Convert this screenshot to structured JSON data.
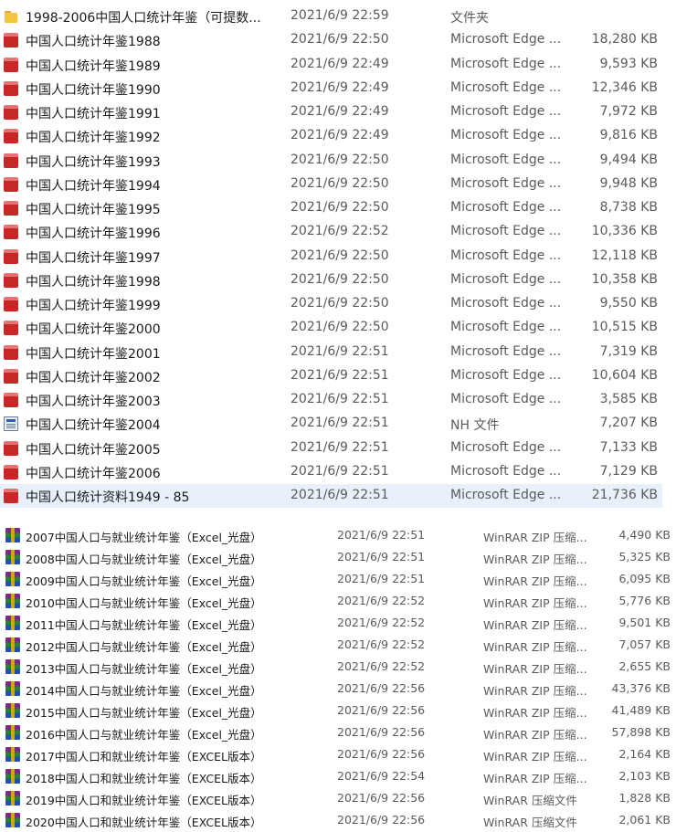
{
  "top_list": [
    {
      "icon": "folder-icon",
      "name": "1998-2006中国人口统计年鉴（可提数...",
      "date": "2021/6/9 22:59",
      "type": "文件夹",
      "size": ""
    },
    {
      "icon": "pdf-icon",
      "name": "中国人口统计年鉴1988",
      "date": "2021/6/9 22:50",
      "type": "Microsoft Edge ...",
      "size": "18,280 KB"
    },
    {
      "icon": "pdf-icon",
      "name": "中国人口统计年鉴1989",
      "date": "2021/6/9 22:49",
      "type": "Microsoft Edge ...",
      "size": "9,593 KB"
    },
    {
      "icon": "pdf-icon",
      "name": "中国人口统计年鉴1990",
      "date": "2021/6/9 22:49",
      "type": "Microsoft Edge ...",
      "size": "12,346 KB"
    },
    {
      "icon": "pdf-icon",
      "name": "中国人口统计年鉴1991",
      "date": "2021/6/9 22:49",
      "type": "Microsoft Edge ...",
      "size": "7,972 KB"
    },
    {
      "icon": "pdf-icon",
      "name": "中国人口统计年鉴1992",
      "date": "2021/6/9 22:49",
      "type": "Microsoft Edge ...",
      "size": "9,816 KB"
    },
    {
      "icon": "pdf-icon",
      "name": "中国人口统计年鉴1993",
      "date": "2021/6/9 22:50",
      "type": "Microsoft Edge ...",
      "size": "9,494 KB"
    },
    {
      "icon": "pdf-icon",
      "name": "中国人口统计年鉴1994",
      "date": "2021/6/9 22:50",
      "type": "Microsoft Edge ...",
      "size": "9,948 KB"
    },
    {
      "icon": "pdf-icon",
      "name": "中国人口统计年鉴1995",
      "date": "2021/6/9 22:50",
      "type": "Microsoft Edge ...",
      "size": "8,738 KB"
    },
    {
      "icon": "pdf-icon",
      "name": "中国人口统计年鉴1996",
      "date": "2021/6/9 22:52",
      "type": "Microsoft Edge ...",
      "size": "10,336 KB"
    },
    {
      "icon": "pdf-icon",
      "name": "中国人口统计年鉴1997",
      "date": "2021/6/9 22:50",
      "type": "Microsoft Edge ...",
      "size": "12,118 KB"
    },
    {
      "icon": "pdf-icon",
      "name": "中国人口统计年鉴1998",
      "date": "2021/6/9 22:50",
      "type": "Microsoft Edge ...",
      "size": "10,358 KB"
    },
    {
      "icon": "pdf-icon",
      "name": "中国人口统计年鉴1999",
      "date": "2021/6/9 22:50",
      "type": "Microsoft Edge ...",
      "size": "9,550 KB"
    },
    {
      "icon": "pdf-icon",
      "name": "中国人口统计年鉴2000",
      "date": "2021/6/9 22:50",
      "type": "Microsoft Edge ...",
      "size": "10,515 KB"
    },
    {
      "icon": "pdf-icon",
      "name": "中国人口统计年鉴2001",
      "date": "2021/6/9 22:51",
      "type": "Microsoft Edge ...",
      "size": "7,319 KB"
    },
    {
      "icon": "pdf-icon",
      "name": "中国人口统计年鉴2002",
      "date": "2021/6/9 22:51",
      "type": "Microsoft Edge ...",
      "size": "10,604 KB"
    },
    {
      "icon": "pdf-icon",
      "name": "中国人口统计年鉴2003",
      "date": "2021/6/9 22:51",
      "type": "Microsoft Edge ...",
      "size": "3,585 KB"
    },
    {
      "icon": "nh-file-icon",
      "name": "中国人口统计年鉴2004",
      "date": "2021/6/9 22:51",
      "type": "NH 文件",
      "size": "7,207 KB"
    },
    {
      "icon": "pdf-icon",
      "name": "中国人口统计年鉴2005",
      "date": "2021/6/9 22:51",
      "type": "Microsoft Edge ...",
      "size": "7,133 KB"
    },
    {
      "icon": "pdf-icon",
      "name": "中国人口统计年鉴2006",
      "date": "2021/6/9 22:51",
      "type": "Microsoft Edge ...",
      "size": "7,129 KB"
    },
    {
      "icon": "pdf-icon",
      "name": "中国人口统计资料1949 - 85",
      "date": "2021/6/9 22:51",
      "type": "Microsoft Edge ...",
      "size": "21,736 KB",
      "selected": true
    }
  ],
  "bottom_list": [
    {
      "icon": "winrar-icon",
      "name": "2007中国人口与就业统计年鉴（Excel_光盘）",
      "date": "2021/6/9 22:51",
      "type": "WinRAR ZIP 压缩...",
      "size": "4,490 KB"
    },
    {
      "icon": "winrar-icon",
      "name": "2008中国人口与就业统计年鉴（Excel_光盘）",
      "date": "2021/6/9 22:51",
      "type": "WinRAR ZIP 压缩...",
      "size": "5,325 KB"
    },
    {
      "icon": "winrar-icon",
      "name": "2009中国人口与就业统计年鉴（Excel_光盘）",
      "date": "2021/6/9 22:51",
      "type": "WinRAR ZIP 压缩...",
      "size": "6,095 KB"
    },
    {
      "icon": "winrar-icon",
      "name": "2010中国人口与就业统计年鉴（Excel_光盘）",
      "date": "2021/6/9 22:52",
      "type": "WinRAR ZIP 压缩...",
      "size": "5,776 KB"
    },
    {
      "icon": "winrar-icon",
      "name": "2011中国人口与就业统计年鉴（Excel_光盘）",
      "date": "2021/6/9 22:52",
      "type": "WinRAR ZIP 压缩...",
      "size": "9,501 KB"
    },
    {
      "icon": "winrar-icon",
      "name": "2012中国人口与就业统计年鉴（Excel_光盘）",
      "date": "2021/6/9 22:52",
      "type": "WinRAR ZIP 压缩...",
      "size": "7,057 KB"
    },
    {
      "icon": "winrar-icon",
      "name": "2013中国人口与就业统计年鉴（Excel_光盘）",
      "date": "2021/6/9 22:52",
      "type": "WinRAR ZIP 压缩...",
      "size": "2,655 KB"
    },
    {
      "icon": "winrar-icon",
      "name": "2014中国人口与就业统计年鉴（Excel_光盘）",
      "date": "2021/6/9 22:56",
      "type": "WinRAR ZIP 压缩...",
      "size": "43,376 KB"
    },
    {
      "icon": "winrar-icon",
      "name": "2015中国人口与就业统计年鉴（Excel_光盘）",
      "date": "2021/6/9 22:56",
      "type": "WinRAR ZIP 压缩...",
      "size": "41,489 KB"
    },
    {
      "icon": "winrar-icon",
      "name": "2016中国人口与就业统计年鉴（Excel_光盘）",
      "date": "2021/6/9 22:56",
      "type": "WinRAR ZIP 压缩...",
      "size": "57,898 KB"
    },
    {
      "icon": "winrar-icon",
      "name": "2017中国人口和就业统计年鉴（EXCEL版本）",
      "date": "2021/6/9 22:56",
      "type": "WinRAR ZIP 压缩...",
      "size": "2,164 KB"
    },
    {
      "icon": "winrar-icon",
      "name": "2018中国人口和就业统计年鉴（EXCEL版本）",
      "date": "2021/6/9 22:54",
      "type": "WinRAR ZIP 压缩...",
      "size": "2,103 KB"
    },
    {
      "icon": "winrar-icon",
      "name": "2019中国人口和就业统计年鉴（EXCEL版本）",
      "date": "2021/6/9 22:56",
      "type": "WinRAR 压缩文件",
      "size": "1,828 KB"
    },
    {
      "icon": "winrar-icon",
      "name": "2020中国人口和就业统计年鉴（EXCEL版本）",
      "date": "2021/6/9 22:56",
      "type": "WinRAR 压缩文件",
      "size": "2,061 KB"
    }
  ],
  "colors": {
    "selection": "#e8f1fb",
    "text": "#1a1a1a",
    "secondary_text": "#5a5a5a"
  }
}
